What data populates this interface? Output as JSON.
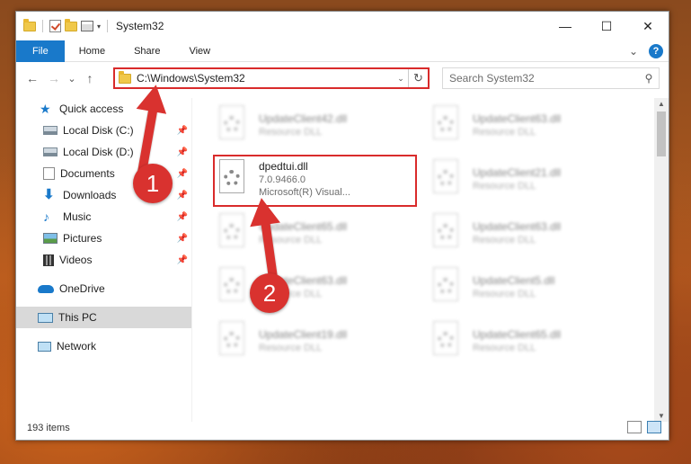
{
  "window": {
    "title": "System32",
    "controls": {
      "minimize": "—",
      "maximize": "☐",
      "close": "✕"
    }
  },
  "ribbon": {
    "tabs": [
      "File",
      "Home",
      "Share",
      "View"
    ],
    "expand": "⌄",
    "help": "?"
  },
  "nav": {
    "back": "←",
    "forward": "→",
    "recent": "⌄",
    "up": "↑",
    "address": "C:\\Windows\\System32",
    "address_dropdown": "⌄",
    "refresh": "↻",
    "search_placeholder": "Search System32",
    "search_icon": "⚲"
  },
  "sidebar": {
    "items": [
      {
        "label": "Quick access",
        "icon": "star-icon",
        "pinned": false
      },
      {
        "label": "Local Disk (C:)",
        "icon": "drive-icon",
        "pinned": true
      },
      {
        "label": "Local Disk (D:)",
        "icon": "drive-icon",
        "pinned": true
      },
      {
        "label": "Documents",
        "icon": "documents-icon",
        "pinned": true
      },
      {
        "label": "Downloads",
        "icon": "download-icon",
        "pinned": true
      },
      {
        "label": "Music",
        "icon": "music-icon",
        "pinned": true
      },
      {
        "label": "Pictures",
        "icon": "pictures-icon",
        "pinned": true
      },
      {
        "label": "Videos",
        "icon": "videos-icon",
        "pinned": true
      },
      {
        "label": "OneDrive",
        "icon": "cloud-icon",
        "pinned": false
      },
      {
        "label": "This PC",
        "icon": "computer-icon",
        "pinned": false,
        "selected": true
      },
      {
        "label": "Network",
        "icon": "network-icon",
        "pinned": false
      }
    ],
    "pin_glyph": "📌"
  },
  "files": {
    "left": [
      {
        "name": "UpdateClient42.dll",
        "sub1": "Resource DLL"
      },
      {
        "name": "dpedtui.dll",
        "sub1": "7.0.9466.0",
        "sub2": "Microsoft(R) Visual..."
      },
      {
        "name": "UpdateClient65.dll",
        "sub1": "Resource DLL"
      },
      {
        "name": "UpdateClient63.dll",
        "sub1": "Resource DLL"
      },
      {
        "name": "UpdateClient19.dll",
        "sub1": "Resource DLL"
      }
    ],
    "right": [
      {
        "name": "UpdateClient63.dll",
        "sub1": "Resource DLL"
      },
      {
        "name": "UpdateClient21.dll",
        "sub1": "Resource DLL"
      },
      {
        "name": "UpdateClient63.dll",
        "sub1": "Resource DLL"
      },
      {
        "name": "UpdateClient5.dll",
        "sub1": "Resource DLL"
      },
      {
        "name": "UpdateClient65.dll",
        "sub1": "Resource DLL"
      }
    ]
  },
  "status": {
    "items": "193 items"
  },
  "annotations": {
    "step1": "1",
    "step2": "2",
    "color": "#d9322f"
  }
}
